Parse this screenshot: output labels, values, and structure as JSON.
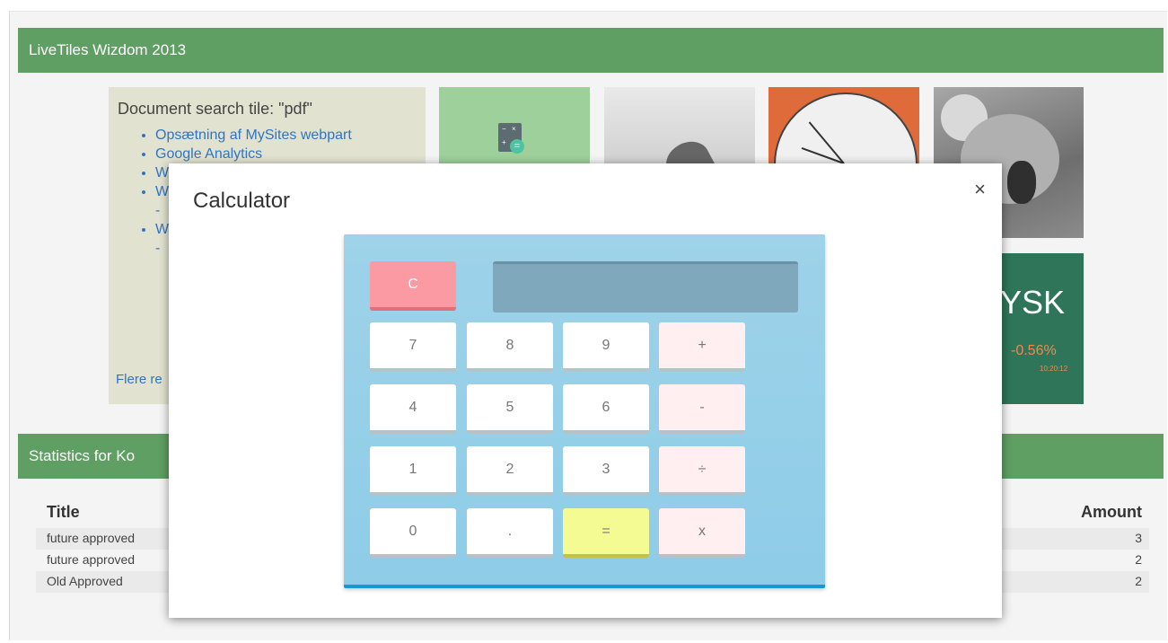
{
  "page": {
    "section1_title": "LiveTiles Wizdom 2013",
    "section2_title": "Statistics for Ko"
  },
  "doc_tile": {
    "title": "Document search tile: \"pdf\"",
    "items": [
      "Opsætning af MySites webpart",
      "Google Analytics",
      "W",
      "W",
      "-",
      "W",
      "-"
    ],
    "more_link": "Flere re"
  },
  "calc_tile": {
    "symbols": [
      "−",
      "×",
      "+",
      "="
    ]
  },
  "stock_tile": {
    "symbol": "YSK",
    "change": "-0.56%",
    "time": "10:20:12"
  },
  "stats": {
    "col_title": "Title",
    "col_amount": "Amount",
    "rows": [
      {
        "title": "future approved",
        "amount": "3"
      },
      {
        "title": "future approved",
        "amount": "2"
      },
      {
        "title": "Old Approved",
        "amount": "2"
      }
    ]
  },
  "dialog": {
    "title": "Calculator",
    "close": "×",
    "keys": {
      "clear": "C",
      "k7": "7",
      "k8": "8",
      "k9": "9",
      "plus": "+",
      "k4": "4",
      "k5": "5",
      "k6": "6",
      "minus": "-",
      "k1": "1",
      "k2": "2",
      "k3": "3",
      "divide": "÷",
      "k0": "0",
      "dot": ".",
      "equals": "=",
      "multiply": "x"
    },
    "display_value": ""
  },
  "colors": {
    "header_green": "#5f9f63",
    "calc_blue": "#9ed3e9",
    "clear_pink": "#fb9aa2",
    "equals_yellow": "#f4fb92"
  }
}
